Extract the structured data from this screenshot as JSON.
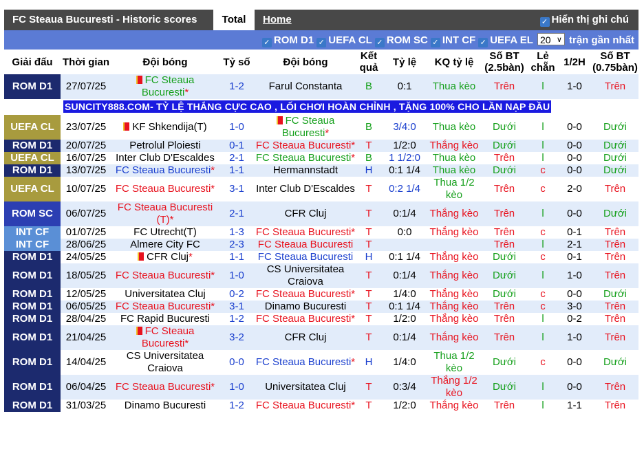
{
  "header": {
    "title": "FC Steaua Bucuresti - Historic scores",
    "tab_total": "Total",
    "tab_home": "Home",
    "show_label": "Hiển thị ghi chú"
  },
  "filters": {
    "items": [
      "ROM D1",
      "UEFA CL",
      "ROM SC",
      "INT CF",
      "UEFA EL"
    ],
    "count_selected": "20",
    "recent_label": "trận gần nhất"
  },
  "columns": [
    "Giải đấu",
    "Thời gian",
    "Đội bóng",
    "Tỷ số",
    "Đội bóng",
    "Kết quả",
    "Tỷ lệ",
    "KQ tỷ lệ",
    "Số BT (2.5bàn)",
    "Lẻ chẵn",
    "1/2H",
    "Số BT (0.75bàn)"
  ],
  "banner": "SUNCITY888.COM- TỶ LỆ THẮNG CỰC CAO , LỐI CHƠI HOÀN CHỈNH , TẶNG 100% CHO LẦN NẠP ĐẦU",
  "league_colors": {
    "ROM D1": "#1c2a6e",
    "UEFA CL": "#a89b3e",
    "ROM SC": "#2c3fb2",
    "INT CF": "#5a8fd6"
  },
  "colors": {
    "red": "#e8121e",
    "green": "#16a01c",
    "blue": "#1a3fce"
  },
  "rows": [
    {
      "league": "ROM D1",
      "date": "27/07/25",
      "home": "FC Steaua Bucuresti",
      "home_c": "g",
      "home_flag": true,
      "home_star": true,
      "score": "1-2",
      "away": "Farul Constanta",
      "away_c": "",
      "res": "B",
      "odds": "0:1",
      "odds_c": "",
      "kq": "Thua kèo",
      "bt": "Trên",
      "lc": "l",
      "half": "1-0",
      "bt2": "Trên"
    },
    {
      "league": "UEFA CL",
      "date": "23/07/25",
      "home": "KF Shkendija(T)",
      "home_c": "",
      "home_flag": true,
      "score": "1-0",
      "away": "FC Steaua Bucuresti",
      "away_c": "g",
      "away_flag": true,
      "away_star": true,
      "res": "B",
      "odds": "3/4:0",
      "odds_c": "b",
      "kq": "Thua kèo",
      "bt": "Dưới",
      "lc": "l",
      "half": "0-0",
      "bt2": "Dưới"
    },
    {
      "league": "ROM D1",
      "date": "20/07/25",
      "home": "Petrolul Ploiesti",
      "home_c": "",
      "score": "0-1",
      "away": "FC Steaua Bucuresti",
      "away_c": "r",
      "away_star": true,
      "res": "T",
      "odds": "1/2:0",
      "odds_c": "",
      "kq": "Thắng kèo",
      "bt": "Dưới",
      "lc": "l",
      "half": "0-0",
      "bt2": "Dưới"
    },
    {
      "league": "UEFA CL",
      "date": "16/07/25",
      "home": "Inter Club D'Escaldes",
      "home_c": "",
      "score": "2-1",
      "away": "FC Steaua Bucuresti",
      "away_c": "g",
      "away_star": true,
      "res": "B",
      "odds": "1 1/2:0",
      "odds_c": "b",
      "kq": "Thua kèo",
      "bt": "Trên",
      "lc": "l",
      "half": "0-0",
      "bt2": "Dưới"
    },
    {
      "league": "ROM D1",
      "date": "13/07/25",
      "home": "FC Steaua Bucuresti",
      "home_c": "b",
      "home_star": true,
      "score": "1-1",
      "away": "Hermannstadt",
      "away_c": "",
      "res": "H",
      "odds": "0:1 1/4",
      "odds_c": "",
      "kq": "Thua kèo",
      "bt": "Dưới",
      "lc": "c",
      "half": "0-0",
      "bt2": "Dưới"
    },
    {
      "league": "UEFA CL",
      "date": "10/07/25",
      "home": "FC Steaua Bucuresti",
      "home_c": "r",
      "home_star": true,
      "score": "3-1",
      "away": "Inter Club D'Escaldes",
      "away_c": "",
      "res": "T",
      "odds": "0:2 1/4",
      "odds_c": "b",
      "kq": "Thua 1/2 kèo",
      "bt": "Trên",
      "lc": "c",
      "half": "2-0",
      "bt2": "Trên"
    },
    {
      "league": "ROM SC",
      "date": "06/07/25",
      "home": "FC Steaua Bucuresti (T)",
      "home_c": "r",
      "home_star": true,
      "score": "2-1",
      "away": "CFR Cluj",
      "away_c": "",
      "res": "T",
      "odds": "0:1/4",
      "odds_c": "",
      "kq": "Thắng kèo",
      "bt": "Trên",
      "lc": "l",
      "half": "0-0",
      "bt2": "Dưới"
    },
    {
      "league": "INT CF",
      "date": "01/07/25",
      "home": "FC Utrecht(T)",
      "home_c": "",
      "score": "1-3",
      "away": "FC Steaua Bucuresti",
      "away_c": "r",
      "away_star": true,
      "res": "T",
      "odds": "0:0",
      "odds_c": "",
      "kq": "Thắng kèo",
      "bt": "Trên",
      "lc": "c",
      "half": "0-1",
      "bt2": "Trên"
    },
    {
      "league": "INT CF",
      "date": "28/06/25",
      "home": "Almere City FC",
      "home_c": "",
      "score": "2-3",
      "away": "FC Steaua Bucuresti",
      "away_c": "r",
      "res": "T",
      "odds": "",
      "odds_c": "",
      "kq": "",
      "bt": "Trên",
      "lc": "l",
      "half": "2-1",
      "bt2": "Trên"
    },
    {
      "league": "ROM D1",
      "date": "24/05/25",
      "home": "CFR Cluj",
      "home_c": "",
      "home_flag": true,
      "home_star": true,
      "score": "1-1",
      "away": "FC Steaua Bucuresti",
      "away_c": "b",
      "res": "H",
      "odds": "0:1 1/4",
      "odds_c": "",
      "kq": "Thắng kèo",
      "bt": "Dưới",
      "lc": "c",
      "half": "0-1",
      "bt2": "Trên"
    },
    {
      "league": "ROM D1",
      "date": "18/05/25",
      "home": "FC Steaua Bucuresti",
      "home_c": "r",
      "home_star": true,
      "score": "1-0",
      "away": "CS Universitatea Craiova",
      "away_c": "",
      "res": "T",
      "odds": "0:1/4",
      "odds_c": "",
      "kq": "Thắng kèo",
      "bt": "Dưới",
      "lc": "l",
      "half": "1-0",
      "bt2": "Trên"
    },
    {
      "league": "ROM D1",
      "date": "12/05/25",
      "home": "Universitatea Cluj",
      "home_c": "",
      "score": "0-2",
      "away": "FC Steaua Bucuresti",
      "away_c": "r",
      "away_star": true,
      "res": "T",
      "odds": "1/4:0",
      "odds_c": "",
      "kq": "Thắng kèo",
      "bt": "Dưới",
      "lc": "c",
      "half": "0-0",
      "bt2": "Dưới"
    },
    {
      "league": "ROM D1",
      "date": "06/05/25",
      "home": "FC Steaua Bucuresti",
      "home_c": "r",
      "home_star": true,
      "score": "3-1",
      "away": "Dinamo Bucuresti",
      "away_c": "",
      "res": "T",
      "odds": "0:1 1/4",
      "odds_c": "",
      "kq": "Thắng kèo",
      "bt": "Trên",
      "lc": "c",
      "half": "3-0",
      "bt2": "Trên"
    },
    {
      "league": "ROM D1",
      "date": "28/04/25",
      "home": "FC Rapid Bucuresti",
      "home_c": "",
      "score": "1-2",
      "away": "FC Steaua Bucuresti",
      "away_c": "r",
      "away_star": true,
      "res": "T",
      "odds": "1/2:0",
      "odds_c": "",
      "kq": "Thắng kèo",
      "bt": "Trên",
      "lc": "l",
      "half": "0-2",
      "bt2": "Trên"
    },
    {
      "league": "ROM D1",
      "date": "21/04/25",
      "home": "FC Steaua Bucuresti",
      "home_c": "r",
      "home_flag": true,
      "home_star": true,
      "score": "3-2",
      "away": "CFR Cluj",
      "away_c": "",
      "res": "T",
      "odds": "0:1/4",
      "odds_c": "",
      "kq": "Thắng kèo",
      "bt": "Trên",
      "lc": "l",
      "half": "1-0",
      "bt2": "Trên"
    },
    {
      "league": "ROM D1",
      "date": "14/04/25",
      "home": "CS Universitatea Craiova",
      "home_c": "",
      "score": "0-0",
      "away": "FC Steaua Bucuresti",
      "away_c": "b",
      "away_star": true,
      "res": "H",
      "odds": "1/4:0",
      "odds_c": "",
      "kq": "Thua 1/2 kèo",
      "bt": "Dưới",
      "lc": "c",
      "half": "0-0",
      "bt2": "Dưới"
    },
    {
      "league": "ROM D1",
      "date": "06/04/25",
      "home": "FC Steaua Bucuresti",
      "home_c": "r",
      "home_star": true,
      "score": "1-0",
      "away": "Universitatea Cluj",
      "away_c": "",
      "res": "T",
      "odds": "0:3/4",
      "odds_c": "",
      "kq": "Thắng 1/2 kèo",
      "bt": "Dưới",
      "lc": "l",
      "half": "0-0",
      "bt2": "Trên"
    },
    {
      "league": "ROM D1",
      "date": "31/03/25",
      "home": "Dinamo Bucuresti",
      "home_c": "",
      "score": "1-2",
      "away": "FC Steaua Bucuresti",
      "away_c": "r",
      "away_star": true,
      "res": "T",
      "odds": "1/2:0",
      "odds_c": "",
      "kq": "Thắng kèo",
      "bt": "Trên",
      "lc": "l",
      "half": "1-1",
      "bt2": "Trên"
    }
  ]
}
